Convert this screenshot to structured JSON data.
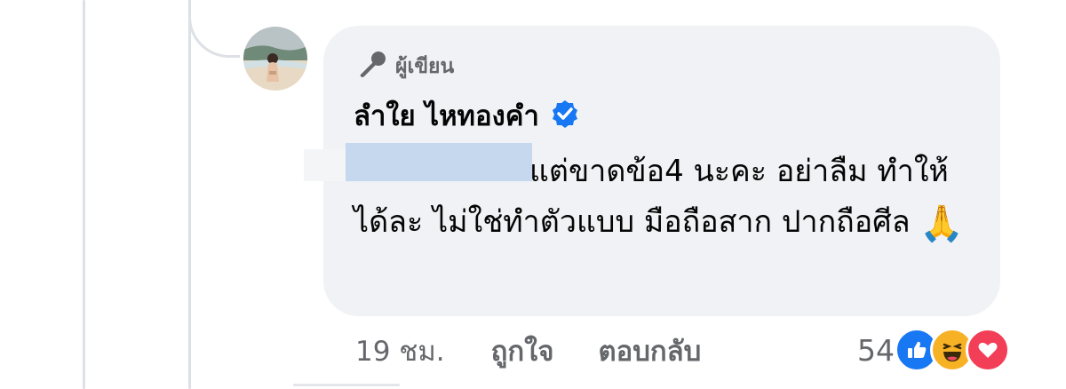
{
  "comment": {
    "author_badge": "ผู้เขียน",
    "commenter_name": "ลำใย ไหทองคำ",
    "text": "แต่ขาดข้อ4 นะคะ อย่าลืม ทำให้ได้ละ ไม่ใช่ทำตัวแบบ มือถือสาก ปากถือศีล",
    "emoji": "🙏",
    "timestamp": "19 ชม.",
    "like_label": "ถูกใจ",
    "reply_label": "ตอบกลับ",
    "reaction_count": "54",
    "reactions": [
      "like-icon",
      "haha-icon",
      "love-icon"
    ]
  },
  "colors": {
    "bubble": "#f0f2f5",
    "verified": "#1877f2",
    "secondary_text": "#65676b",
    "love": "#f33e58",
    "haha": "#f7b125"
  }
}
